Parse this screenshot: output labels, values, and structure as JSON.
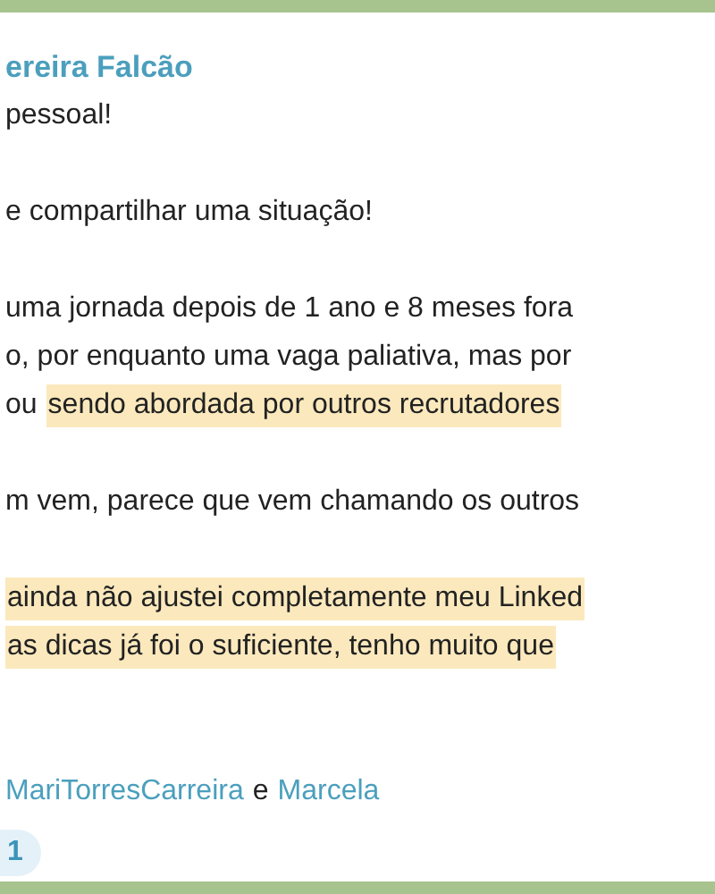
{
  "message": {
    "sender": "ereira Falcão",
    "paragraphs": [
      {
        "lines": [
          {
            "segments": [
              {
                "text": "pessoal!",
                "highlighted": false
              }
            ]
          }
        ]
      },
      {
        "lines": [
          {
            "segments": [
              {
                "text": "e compartilhar uma situação!",
                "highlighted": false
              }
            ]
          }
        ]
      },
      {
        "lines": [
          {
            "segments": [
              {
                "text": "uma jornada depois de 1 ano e 8 meses fora",
                "highlighted": false
              }
            ]
          },
          {
            "segments": [
              {
                "text": "o, por enquanto uma vaga paliativa, mas por",
                "highlighted": false
              }
            ]
          },
          {
            "segments": [
              {
                "text": "ou",
                "highlighted": false
              },
              {
                "text": "sendo abordada por outros recrutadores",
                "highlighted": true
              }
            ]
          }
        ]
      },
      {
        "lines": [
          {
            "segments": [
              {
                "text": "m vem, parece que vem chamando os outros",
                "highlighted": false
              }
            ]
          }
        ]
      },
      {
        "lines": [
          {
            "segments": [
              {
                "text": "ainda não ajustei completamente meu Linked",
                "highlighted": true
              }
            ]
          },
          {
            "segments": [
              {
                "text": "as dicas já foi o suficiente, tenho muito que",
                "highlighted": true
              }
            ]
          }
        ]
      }
    ],
    "mentions": [
      {
        "text": "MariTorresCarreira",
        "kind": "link"
      },
      {
        "text": "e",
        "kind": "plain"
      },
      {
        "text": "Marcela",
        "kind": "link"
      }
    ],
    "reaction": {
      "count": "1"
    }
  }
}
